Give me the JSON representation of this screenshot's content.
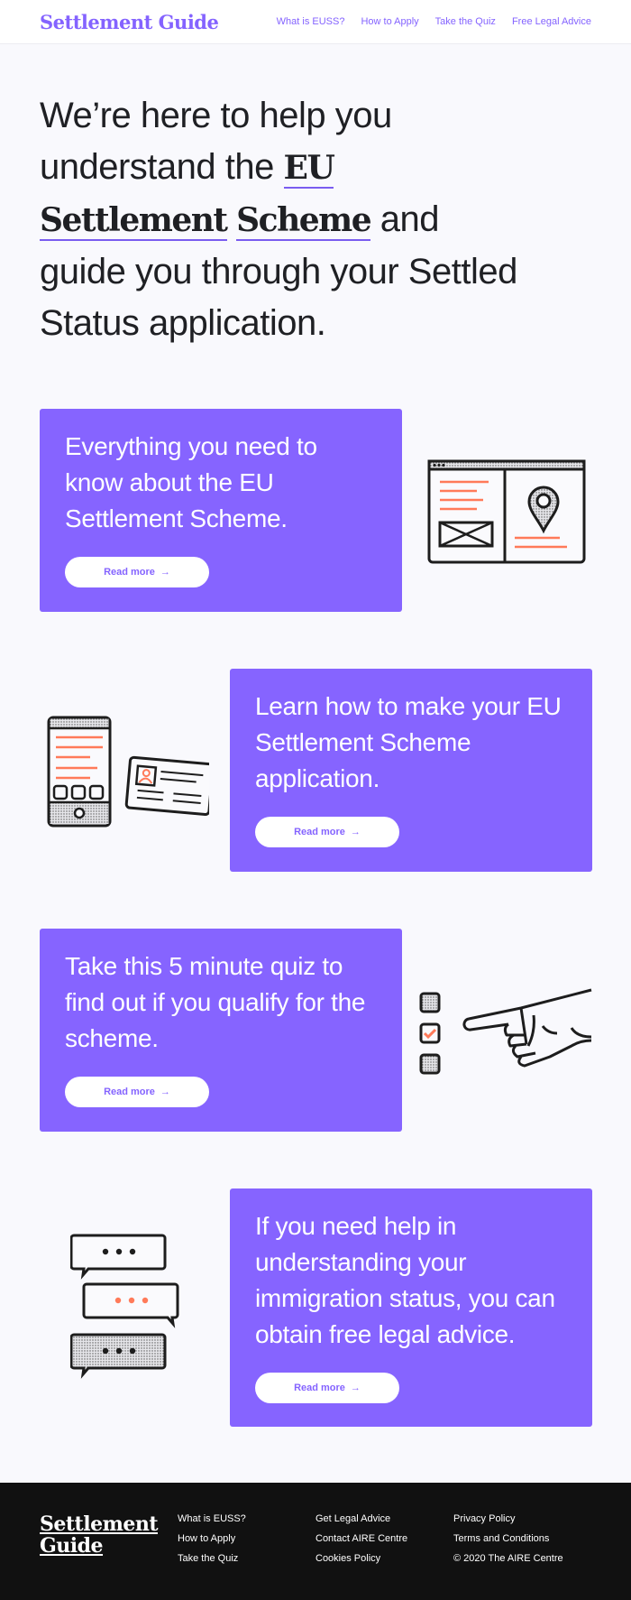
{
  "header": {
    "logo": "Settlement Guide",
    "nav": [
      "What is EUSS?",
      "How to Apply",
      "Take the Quiz",
      "Free Legal Advice"
    ]
  },
  "hero": {
    "part1": "We’re here to help you understand the ",
    "em1": "EU",
    "em2": "Settlement",
    "em3": "Scheme",
    "part2": " and guide you through your Settled Status application."
  },
  "features": [
    {
      "text": "Everything you need to know about the EU Settlement Scheme.",
      "button": "Read more",
      "illustration": "browser-map-icon"
    },
    {
      "text": "Learn how to make your EU Settlement Scheme application.",
      "button": "Read more",
      "illustration": "phone-id-card-icon"
    },
    {
      "text": "Take this 5 minute quiz to find out if you qualify for the scheme.",
      "button": "Read more",
      "illustration": "checklist-pointing-hand-icon"
    },
    {
      "text": "If you need help in understanding your immigration status, you can obtain free legal advice.",
      "button": "Read more",
      "illustration": "chat-bubbles-icon"
    }
  ],
  "footer": {
    "logo_line1": "Settlement",
    "logo_line2": "Guide",
    "col1": [
      "What is EUSS?",
      "How to Apply",
      "Take the Quiz"
    ],
    "col2": [
      "Get Legal Advice",
      "Contact AIRE Centre",
      "Cookies Policy"
    ],
    "col3": [
      "Privacy Policy",
      "Terms and Conditions"
    ],
    "copyright": "© 2020 The AIRE Centre"
  },
  "colors": {
    "accent": "#8664ff",
    "illustration_accent": "#ff7a59",
    "footer_bg": "#111111"
  }
}
